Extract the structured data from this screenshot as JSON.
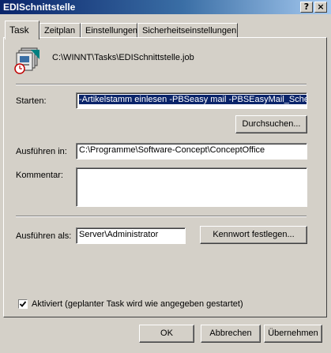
{
  "window": {
    "title": "EDISchnittstelle",
    "help_button": "?",
    "close_button": "×"
  },
  "tabs": [
    {
      "label": "Task",
      "active": true
    },
    {
      "label": "Zeitplan",
      "active": false
    },
    {
      "label": "Einstellungen",
      "active": false
    },
    {
      "label": "Sicherheitseinstellungen",
      "active": false
    }
  ],
  "task": {
    "icon": "scheduled-task-icon",
    "file_path": "C:\\WINNT\\Tasks\\EDISchnittstelle.job",
    "starten_label": "Starten:",
    "starten_value": "-Artikelstamm einlesen -PBSeasy mail -PBSEasyMail_Schema",
    "browse_button": "Durchsuchen...",
    "ausfuehren_in_label": "Ausführen in:",
    "ausfuehren_in_value": "C:\\Programme\\Software-Concept\\ConceptOffice",
    "kommentar_label": "Kommentar:",
    "kommentar_value": "",
    "ausfuehren_als_label": "Ausführen als:",
    "ausfuehren_als_value": "Server\\Administrator",
    "password_button": "Kennwort festlegen...",
    "aktiviert_label": "Aktiviert (geplanter Task wird wie angegeben gestartet)",
    "aktiviert_checked": true
  },
  "footer": {
    "ok": "OK",
    "cancel": "Abbrechen",
    "apply": "Übernehmen"
  }
}
